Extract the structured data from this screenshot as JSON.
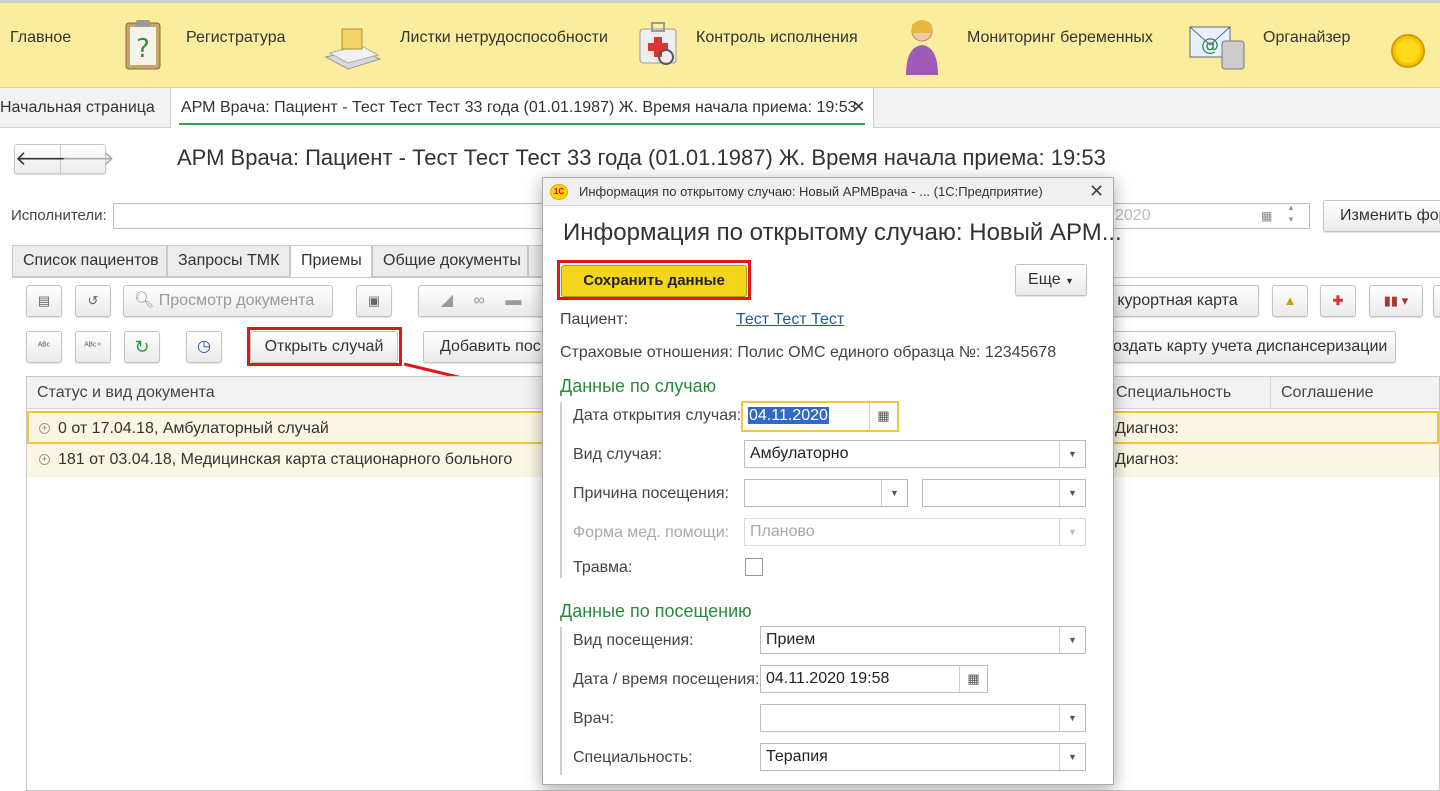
{
  "sections": [
    {
      "label": "Главное",
      "icon": "home-icon"
    },
    {
      "label": "Регистратура",
      "icon": "registry-clipboard-icon"
    },
    {
      "label": "Листки нетрудоспособности",
      "icon": "sick-leave-icon"
    },
    {
      "label": "Контроль исполнения",
      "icon": "control-first-aid-icon"
    },
    {
      "label": "Мониторинг беременных",
      "icon": "pregnant-woman-icon"
    },
    {
      "label": "Органайзер",
      "icon": "organizer-email-icon"
    }
  ],
  "window_tabs": [
    {
      "label": "Начальная страница"
    },
    {
      "label": "АРМ Врача: Пациент - Тест Тест Тест 33 года  (01.01.1987) Ж. Время начала приема: 19:53"
    }
  ],
  "page": {
    "title": "АРМ Врача: Пациент - Тест Тест Тест 33 года  (01.01.1987) Ж. Время начала приема: 19:53",
    "performers_label": "Исполнители:",
    "date_fragment": "2020",
    "change_form_label": "Изменить фор"
  },
  "inner_tabs": [
    "Список пациентов",
    "Запросы ТМК",
    "Приемы",
    "Общие документы"
  ],
  "toolbar": {
    "view_doc_placeholder": "Просмотр документа",
    "open_case_label": "Открыть случай",
    "add_visit_label": "Добавить пос",
    "resort_card_label": "о курортная карта",
    "create_dispensary_label": "оздать карту учета диспансеризации"
  },
  "grid": {
    "columns": [
      "Статус и вид документа",
      "Специальность",
      "Соглашение"
    ],
    "rows": [
      {
        "doc": "0 от 17.04.18, Амбулаторный случай",
        "specialty": "Диагноз:",
        "selected": true
      },
      {
        "doc": "181 от 03.04.18, Медицинская карта стационарного больного",
        "specialty": "Диагноз:",
        "selected": false
      }
    ]
  },
  "dialog": {
    "window_title": "Информация по открытому случаю: Новый АРМВрача - ...  (1С:Предприятие)",
    "logo_text": "1С",
    "heading": "Информация по открытому случаю: Новый АРМ...",
    "save_label": "Сохранить данные",
    "more_label": "Еще",
    "patient_label": "Пациент:",
    "patient_value": "Тест Тест Тест",
    "insurance_text": "Страховые отношения: Полис ОМС единого образца №: 12345678",
    "case_group": {
      "title": "Данные по случаю",
      "open_date_label": "Дата открытия случая:",
      "open_date_value": "04.11.2020",
      "case_type_label": "Вид случая:",
      "case_type_value": "Амбулаторно",
      "visit_reason_label": "Причина посещения:",
      "visit_reason_value1": "",
      "visit_reason_value2": "",
      "care_form_label": "Форма мед. помощи:",
      "care_form_value": "Планово",
      "trauma_label": "Травма:"
    },
    "visit_group": {
      "title": "Данные по посещению",
      "visit_type_label": "Вид посещения:",
      "visit_type_value": "Прием",
      "visit_datetime_label": "Дата / время посещения:",
      "visit_datetime_value": "04.11.2020 19:58",
      "doctor_label": "Врач:",
      "doctor_value": "",
      "specialty_label": "Специальность:",
      "specialty_value": "Терапия"
    }
  },
  "colors": {
    "topbar": "#fbed9e",
    "save_button": "#f3d51c",
    "highlight_red": "#e0161b",
    "group_green": "#2a8a3e",
    "link_blue": "#2255a4"
  }
}
